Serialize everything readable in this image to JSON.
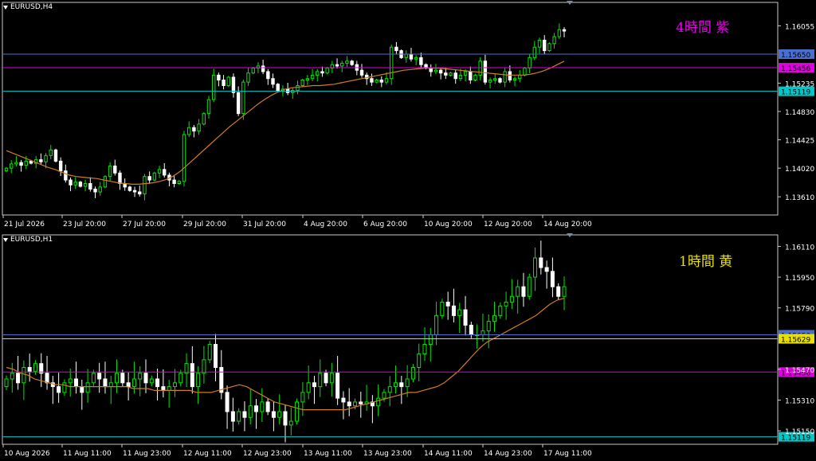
{
  "colors": {
    "bull": "#00e600",
    "bear": "#ffffff",
    "ma": "#d07d1e",
    "frame": "#c8c8c8",
    "label_purple": "#e000e0",
    "label_yellow": "#e8e000"
  },
  "panels": [
    {
      "symbol": "EURUSD,H4",
      "label": "4時間  紫",
      "label_color": "#e000e0",
      "chart_data": {
        "type": "candlestick",
        "ylim": [
          1.1335,
          1.1639
        ],
        "y_ticks": [
          "1.16055",
          "1.15235",
          "1.14830",
          "1.14425",
          "1.14020",
          "1.13610"
        ],
        "x_ticks": [
          "21 Jul 2026",
          "23 Jul 20:00",
          "27 Jul 20:00",
          "29 Jul 20:00",
          "31 Jul 20:00",
          "4 Aug 20:00",
          "6 Aug 20:00",
          "10 Aug 20:00",
          "12 Aug 20:00",
          "14 Aug 20:00"
        ],
        "levels": [
          {
            "value": 1.1565,
            "label": "1.15650",
            "color": "#4a6fd1"
          },
          {
            "value": 1.15456,
            "label": "1.15456",
            "color": "#e000e0"
          },
          {
            "value": 1.15119,
            "label": "1.15119",
            "color": "#00c8c8"
          }
        ],
        "closes": [
          1.1402,
          1.1408,
          1.141,
          1.1406,
          1.1412,
          1.1409,
          1.1414,
          1.1411,
          1.142,
          1.1428,
          1.1412,
          1.1398,
          1.1385,
          1.1378,
          1.1382,
          1.1376,
          1.138,
          1.1372,
          1.1368,
          1.1375,
          1.139,
          1.1405,
          1.1395,
          1.138,
          1.1375,
          1.137,
          1.1368,
          1.1365,
          1.139,
          1.1385,
          1.1395,
          1.14,
          1.1392,
          1.1385,
          1.138,
          1.1383,
          1.145,
          1.146,
          1.1455,
          1.1465,
          1.148,
          1.15,
          1.1535,
          1.1528,
          1.152,
          1.1532,
          1.151,
          1.148,
          1.1525,
          1.1538,
          1.1545,
          1.1548,
          1.154,
          1.153,
          1.1522,
          1.1512,
          1.1515,
          1.151,
          1.1513,
          1.152,
          1.1528,
          1.153,
          1.1535,
          1.154,
          1.1538,
          1.1545,
          1.155,
          1.1548,
          1.1552,
          1.1555,
          1.155,
          1.1542,
          1.1535,
          1.153,
          1.1525,
          1.1528,
          1.1525,
          1.153,
          1.1575,
          1.157,
          1.156,
          1.1565,
          1.1558,
          1.156,
          1.155,
          1.1545,
          1.154,
          1.1542,
          1.1538,
          1.1535,
          1.1538,
          1.153,
          1.1535,
          1.154,
          1.1528,
          1.1535,
          1.1555,
          1.1525,
          1.1528,
          1.153,
          1.1525,
          1.154,
          1.1528,
          1.153,
          1.1535,
          1.1545,
          1.156,
          1.1575,
          1.1585,
          1.157,
          1.158,
          1.159,
          1.16,
          1.1598
        ],
        "ma_closes": [
          1.1427,
          1.1423,
          1.1419,
          1.1415,
          1.1411,
          1.1407,
          1.1403,
          1.14,
          1.1396,
          1.1392,
          1.139,
          1.1389,
          1.1388,
          1.1387,
          1.1385,
          1.1383,
          1.1381,
          1.138,
          1.1379,
          1.1379,
          1.138,
          1.1381,
          1.1383,
          1.1386,
          1.1391,
          1.1398,
          1.1407,
          1.1416,
          1.1425,
          1.1434,
          1.1443,
          1.1452,
          1.1461,
          1.1469,
          1.1477,
          1.1485,
          1.1493,
          1.15,
          1.1506,
          1.1511,
          1.1515,
          1.1517,
          1.1518,
          1.1519,
          1.152,
          1.152,
          1.1521,
          1.1522,
          1.1524,
          1.1526,
          1.1528,
          1.153,
          1.1532,
          1.1534,
          1.1536,
          1.1538,
          1.154,
          1.1542,
          1.1543,
          1.1544,
          1.1545,
          1.1545,
          1.1545,
          1.1544,
          1.1543,
          1.1542,
          1.1541,
          1.154,
          1.1539,
          1.1538,
          1.1537,
          1.1536,
          1.1535,
          1.1535,
          1.1535,
          1.1536,
          1.1538,
          1.1541,
          1.1545,
          1.155,
          1.1555
        ],
        "ma_offset": 0
      }
    },
    {
      "symbol": "EURUSD,H1",
      "label": "1時間  黄",
      "label_color": "#e8e000",
      "chart_data": {
        "type": "candlestick",
        "ylim": [
          1.1508,
          1.1617
        ],
        "y_ticks": [
          "1.16110",
          "1.15950",
          "1.15790",
          "1.15470",
          "1.15310",
          "1.15150"
        ],
        "x_ticks": [
          "10 Aug 2026",
          "11 Aug 11:00",
          "11 Aug 23:00",
          "12 Aug 11:00",
          "12 Aug 23:00",
          "13 Aug 11:00",
          "13 Aug 23:00",
          "14 Aug 11:00",
          "14 Aug 23:00",
          "17 Aug 11:00"
        ],
        "levels": [
          {
            "value": 1.1565,
            "label": "1.15650",
            "color": "#4a6fd1"
          },
          {
            "value": 1.15629,
            "label": "1.15629",
            "color": "#e8e000"
          },
          {
            "value": 1.15456,
            "label": "1.15456",
            "color": "#e000e0"
          },
          {
            "value": 1.15119,
            "label": "1.15119",
            "color": "#00c8c8"
          }
        ],
        "closes": [
          1.1542,
          1.1545,
          1.154,
          1.1548,
          1.1546,
          1.155,
          1.1545,
          1.154,
          1.1538,
          1.1535,
          1.154,
          1.1542,
          1.1538,
          1.1535,
          1.154,
          1.1545,
          1.1542,
          1.1538,
          1.154,
          1.1545,
          1.154,
          1.1538,
          1.1542,
          1.1545,
          1.154,
          1.1542,
          1.1538,
          1.1536,
          1.1538,
          1.154,
          1.1545,
          1.155,
          1.1538,
          1.1545,
          1.1552,
          1.156,
          1.1548,
          1.1535,
          1.1525,
          1.152,
          1.1525,
          1.1522,
          1.1528,
          1.1525,
          1.153,
          1.1525,
          1.1522,
          1.1525,
          1.1518,
          1.152,
          1.153,
          1.1535,
          1.154,
          1.1538,
          1.1545,
          1.154,
          1.1545,
          1.1532,
          1.153,
          1.1528,
          1.153,
          1.1529,
          1.153,
          1.1528,
          1.1532,
          1.1535,
          1.1538,
          1.154,
          1.1538,
          1.1542,
          1.1548,
          1.1555,
          1.156,
          1.1565,
          1.1575,
          1.1582,
          1.158,
          1.1575,
          1.1578,
          1.157,
          1.1565,
          1.1565,
          1.1567,
          1.1572,
          1.1575,
          1.158,
          1.1582,
          1.1585,
          1.159,
          1.1585,
          1.1595,
          1.1605,
          1.16,
          1.1598,
          1.159,
          1.1585,
          1.159
        ],
        "ma_closes": [
          1.1548,
          1.1547,
          1.1545,
          1.1544,
          1.1542,
          1.1541,
          1.154,
          1.1539,
          1.1539,
          1.1538,
          1.1538,
          1.1538,
          1.1538,
          1.1538,
          1.1538,
          1.1538,
          1.1538,
          1.1538,
          1.1537,
          1.1537,
          1.1537,
          1.1536,
          1.1536,
          1.1536,
          1.1536,
          1.1536,
          1.1536,
          1.1535,
          1.1535,
          1.1535,
          1.1536,
          1.1537,
          1.1538,
          1.1539,
          1.1538,
          1.1536,
          1.1534,
          1.1532,
          1.153,
          1.1529,
          1.1528,
          1.1527,
          1.1526,
          1.1526,
          1.1526,
          1.1526,
          1.1526,
          1.1526,
          1.1526,
          1.1527,
          1.1528,
          1.1529,
          1.153,
          1.1531,
          1.1532,
          1.1533,
          1.1534,
          1.1535,
          1.1535,
          1.1536,
          1.1537,
          1.1538,
          1.154,
          1.1543,
          1.1546,
          1.155,
          1.1554,
          1.1558,
          1.1561,
          1.1563,
          1.1565,
          1.1567,
          1.1569,
          1.1571,
          1.1573,
          1.1575,
          1.1578,
          1.1581,
          1.1583,
          1.1584
        ],
        "ma_offset": 0
      }
    }
  ]
}
